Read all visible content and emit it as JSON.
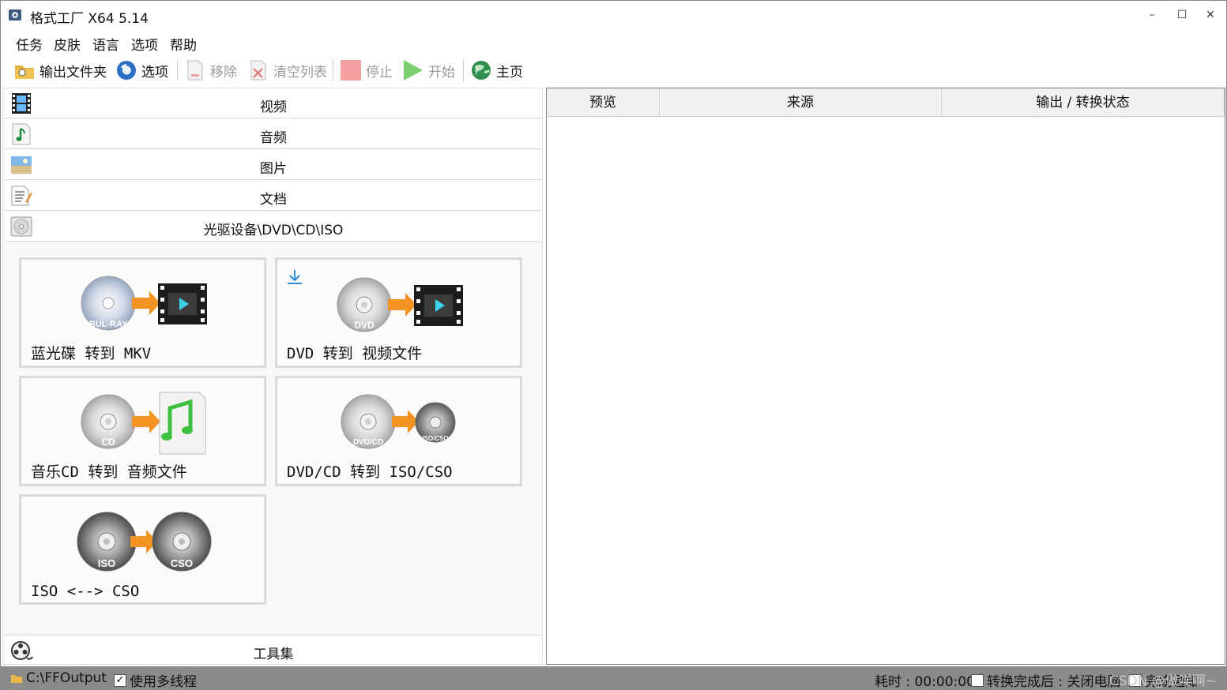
{
  "window": {
    "title": "格式工厂 X64 5.14",
    "minimize": "–",
    "maximize": "☐",
    "close": "✕"
  },
  "menu": [
    "任务",
    "皮肤",
    "语言",
    "选项",
    "帮助"
  ],
  "toolbar": {
    "output_folder": "输出文件夹",
    "options": "选项",
    "remove": "移除",
    "clear_list": "清空列表",
    "stop": "停止",
    "start": "开始",
    "home": "主页"
  },
  "categories": [
    {
      "label": "视频",
      "icon": "film-icon"
    },
    {
      "label": "音频",
      "icon": "music-note-icon"
    },
    {
      "label": "图片",
      "icon": "picture-icon"
    },
    {
      "label": "文档",
      "icon": "document-icon"
    },
    {
      "label": "光驱设备\\DVD\\CD\\ISO",
      "icon": "disc-drive-icon"
    }
  ],
  "tiles": [
    {
      "label": "蓝光碟 转到 MKV",
      "source_disc": "BUL-RAY",
      "target": "video"
    },
    {
      "label": "DVD 转到 视频文件",
      "source_disc": "DVD",
      "target": "video"
    },
    {
      "label": "音乐CD 转到 音频文件",
      "source_disc": "CD",
      "target": "music"
    },
    {
      "label": "DVD/CD 转到 ISO/CSO",
      "source_disc": "DVD/CD",
      "target_disc": "ISO/CSO"
    },
    {
      "label": "ISO <--> CSO",
      "source_disc": "ISO",
      "target_disc": "CSO"
    }
  ],
  "toolset": {
    "label": "工具集",
    "icon": "film-reel-icon"
  },
  "table": {
    "columns": [
      "预览",
      "来源",
      "输出 / 转换状态"
    ]
  },
  "statusbar": {
    "output_path": "C:\\FFOutput",
    "multithread_label": "使用多线程",
    "multithread_checked": true,
    "elapsed": "耗时 : 00:00:00",
    "after_done_label": "转换完成后 : 关闭电脑",
    "after_done_checked": false,
    "notify_label": "完成通知",
    "watermark": "CSDN @做咩啊~"
  },
  "colors": {
    "statusbar_bg": "#8b8b8b",
    "arrow_orange": "#f39321",
    "start_green": "#7ccf6f",
    "stop_red": "#f2a0a0"
  }
}
